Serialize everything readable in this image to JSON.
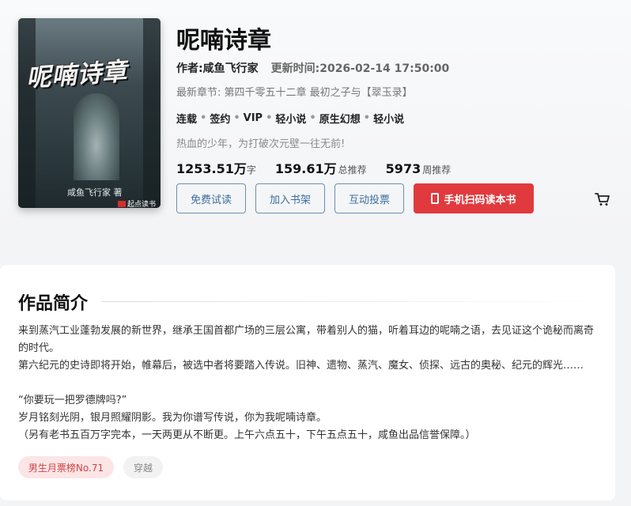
{
  "book": {
    "title": "呢喃诗章",
    "author_line": "作者:咸鱼飞行家",
    "updated_line": "更新时间:2026-02-14 17:50:00",
    "latest_chapter": "最新章节: 第四千零五十二章 最初之子与【翠玉录】",
    "tags": [
      "连载",
      "签约",
      "VIP",
      "轻小说",
      "原生幻想",
      "轻小说"
    ],
    "tagline": "热血的少年，为打破次元壁一往无前!",
    "stats": {
      "words_value": "1253.51万",
      "words_unit": "字",
      "recommend_value": "159.61万",
      "recommend_label": "总推荐",
      "weekly_value": "5973",
      "weekly_label": "周推荐"
    }
  },
  "cover": {
    "title": "呢喃诗章",
    "author": "咸鱼飞行家 著",
    "publisher": "起点读书"
  },
  "actions": {
    "free_trial": "免费试读",
    "add_shelf": "加入书架",
    "vote": "互动投票",
    "scan_read": "手机扫码读本书"
  },
  "summary": {
    "heading": "作品简介",
    "paragraphs": [
      "来到蒸汽工业蓬勃发展的新世界，继承王国首都广场的三层公寓，带着别人的猫，听着耳边的呢喃之语，去见证这个诡秘而离奇的时代。",
      "第六纪元的史诗即将开始，帷幕后，被选中者将要踏入传说。旧神、遗物、蒸汽、魔女、侦探、远古的奥秘、纪元的辉光……",
      "“你要玩一把罗德牌吗?”",
      "岁月铭刻光阴，银月照耀阴影。我为你谱写传说，你为我呢喃诗章。",
      "（另有老书五百万字完本，一天两更从不断更。上午六点五十，下午五点五十，咸鱼出品信誉保障。）"
    ],
    "rank_badge": "男生月票榜No.71",
    "genre_badge": "穿越"
  },
  "colors": {
    "accent_red": "#e03a3e",
    "link_blue": "#3b6e9e"
  }
}
